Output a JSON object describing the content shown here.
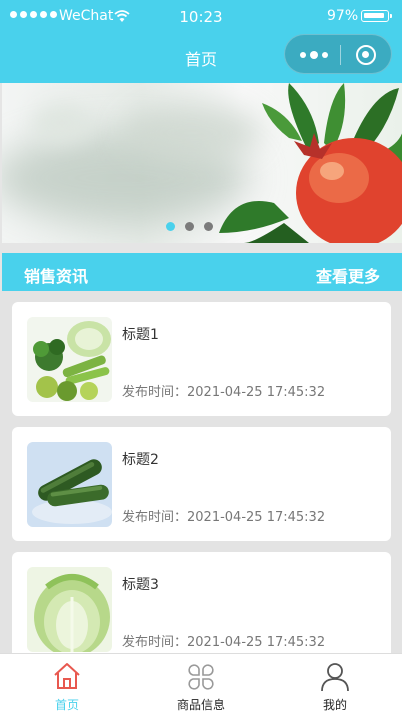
{
  "status_bar": {
    "carrier": "WeChat",
    "time": "10:23",
    "battery": "97%"
  },
  "nav": {
    "title": "首页"
  },
  "banner": {
    "slide_count": 3,
    "active_index": 0
  },
  "section": {
    "title": "销售资讯",
    "more_label": "查看更多"
  },
  "articles": [
    {
      "title": "标题1",
      "date_label": "发布时间：",
      "date": "2021-04-25 17:45:32",
      "image": "vegetables-assortment"
    },
    {
      "title": "标题2",
      "date_label": "发布时间：",
      "date": "2021-04-25 17:45:32",
      "image": "cucumbers"
    },
    {
      "title": "标题3",
      "date_label": "发布时间：",
      "date": "2021-04-25 17:45:32",
      "image": "napa-cabbage"
    }
  ],
  "tabbar": {
    "items": [
      {
        "label": "首页",
        "icon": "home-icon",
        "active": true
      },
      {
        "label": "商品信息",
        "icon": "grid-icon",
        "active": false
      },
      {
        "label": "我的",
        "icon": "user-icon",
        "active": false
      }
    ]
  },
  "colors": {
    "accent": "#49d1ec",
    "home_icon": "#e8584f"
  }
}
